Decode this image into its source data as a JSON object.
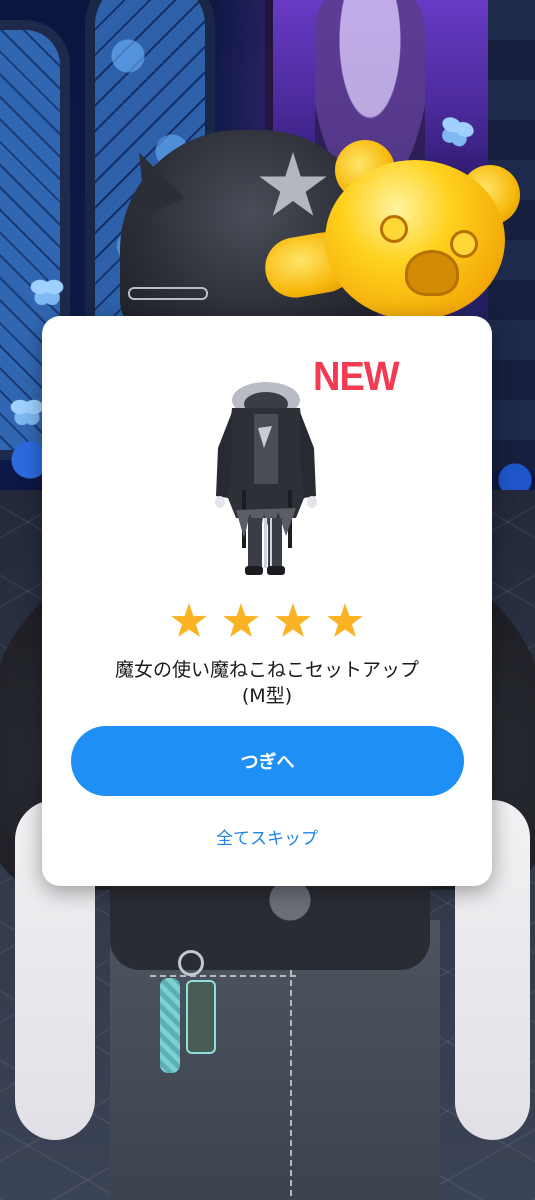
{
  "badge": {
    "label": "NEW"
  },
  "item": {
    "icon": "outfit-set-icon",
    "rarity_stars": 4,
    "name_line1": "魔女の使い魔ねこねこセットアップ",
    "name_line2": "(M型)"
  },
  "buttons": {
    "next_label": "つぎへ",
    "skip_label": "全てスキップ"
  },
  "colors": {
    "badge": "#f23b52",
    "star": "#f9b323",
    "primary_button": "#1e90f5",
    "link": "#1e84e6",
    "modal_bg": "#ffffff"
  }
}
